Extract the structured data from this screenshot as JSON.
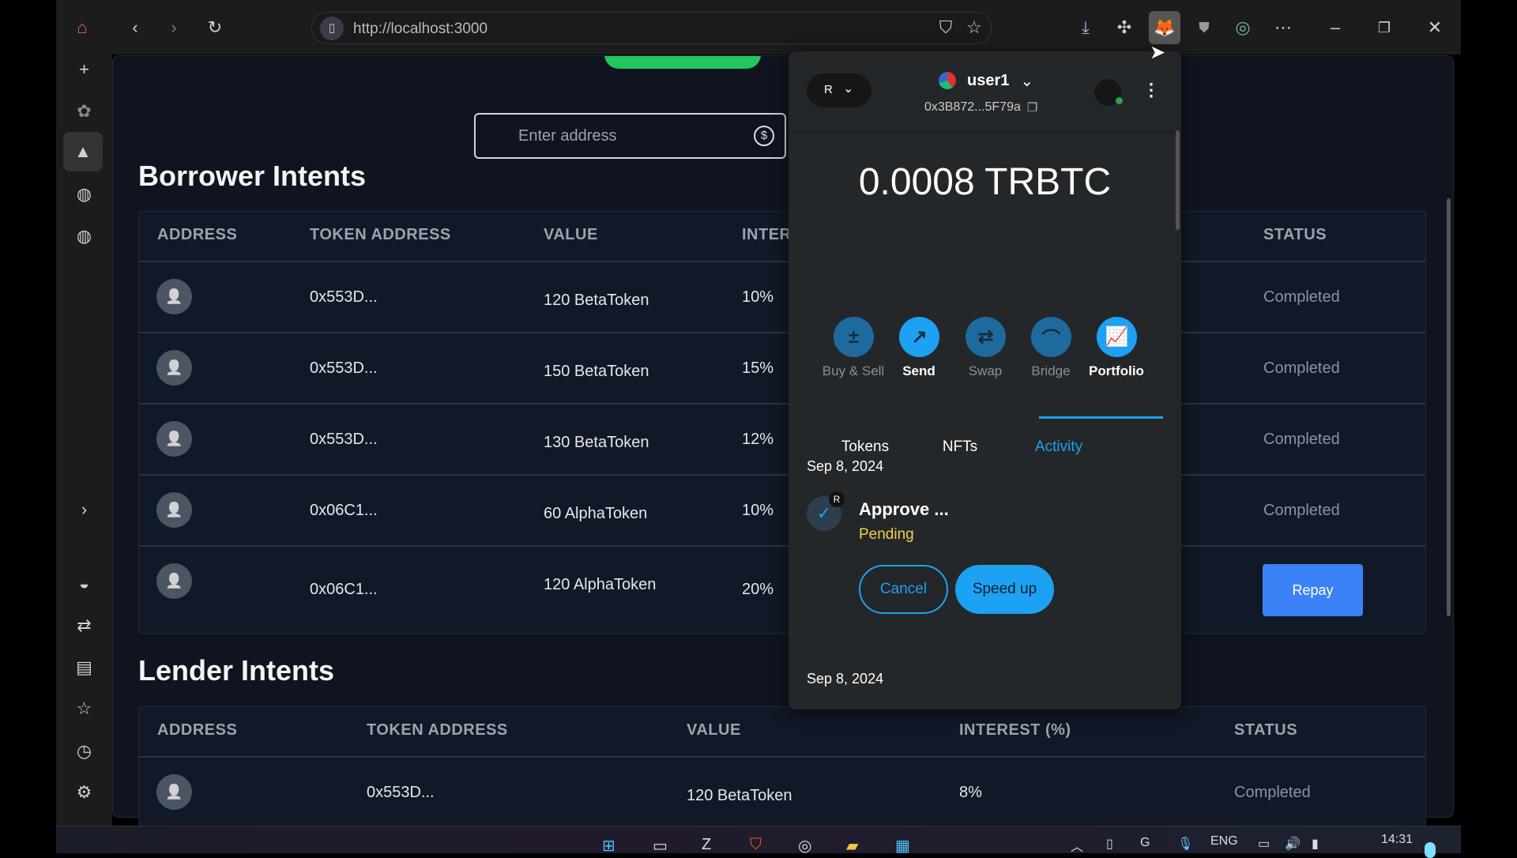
{
  "browser": {
    "url": "http://localhost:3000",
    "icons": [
      "home-icon",
      "back-icon",
      "forward-icon",
      "reload-icon",
      "page-icon",
      "shield-icon",
      "star-icon",
      "download-icon",
      "extensions-icon",
      "metamask-icon",
      "ublock-icon",
      "privacy-icon",
      "more-icon",
      "minimize-icon",
      "restore-icon",
      "close-icon"
    ]
  },
  "sidebar": {
    "icons": [
      "new-tab-icon",
      "extension-icon",
      "aurora-icon",
      "globe-icon",
      "globe-icon",
      "expand-icon",
      "vpn-icon",
      "swap-icon",
      "reading-list-icon",
      "favorites-icon",
      "history-icon",
      "settings-icon"
    ]
  },
  "page": {
    "address_placeholder": "Enter address",
    "borrower": {
      "title": "Borrower Intents",
      "headers": [
        "ADDRESS",
        "TOKEN ADDRESS",
        "VALUE",
        "INTER",
        "STATUS"
      ],
      "rows": [
        {
          "token": "0x553D...",
          "value": "120 BetaToken",
          "interest": "10%",
          "status": "Completed"
        },
        {
          "token": "0x553D...",
          "value": "150 BetaToken",
          "interest": "15%",
          "status": "Completed"
        },
        {
          "token": "0x553D...",
          "value": "130 BetaToken",
          "interest": "12%",
          "status": "Completed"
        },
        {
          "token": "0x06C1...",
          "value": "60 AlphaToken",
          "interest": "10%",
          "status": "Completed"
        },
        {
          "token": "0x06C1...",
          "value": "120 AlphaToken",
          "interest": "20%",
          "status": "",
          "action": "Repay"
        }
      ]
    },
    "lender": {
      "title": "Lender Intents",
      "headers": [
        "ADDRESS",
        "TOKEN ADDRESS",
        "VALUE",
        "INTEREST (%)",
        "STATUS"
      ],
      "rows": [
        {
          "token": "0x553D...",
          "value": "120 BetaToken",
          "interest": "8%",
          "status": "Completed"
        }
      ]
    }
  },
  "wallet": {
    "network": "R",
    "account": "user1",
    "address": "0x3B872...5F79a",
    "balance": "0.0008 TRBTC",
    "actions": [
      {
        "label": "Buy & Sell",
        "icon": "buy-sell-icon"
      },
      {
        "label": "Send",
        "icon": "send-icon"
      },
      {
        "label": "Swap",
        "icon": "swap-icon"
      },
      {
        "label": "Bridge",
        "icon": "bridge-icon"
      },
      {
        "label": "Portfolio",
        "icon": "portfolio-icon"
      }
    ],
    "tabs": [
      "Tokens",
      "NFTs",
      "Activity"
    ],
    "active_tab": "Activity",
    "activity": [
      {
        "date": "Sep 8, 2024",
        "title": "Approve ...",
        "status": "Pending",
        "badge": "R",
        "cancel": "Cancel",
        "speed_up": "Speed up"
      },
      {
        "date": "Sep 8, 2024"
      }
    ],
    "colors": {
      "accent": "#1da1f2",
      "pending": "#f0d04a"
    }
  },
  "taskbar": {
    "lang": "ENG",
    "time": "14:31"
  }
}
